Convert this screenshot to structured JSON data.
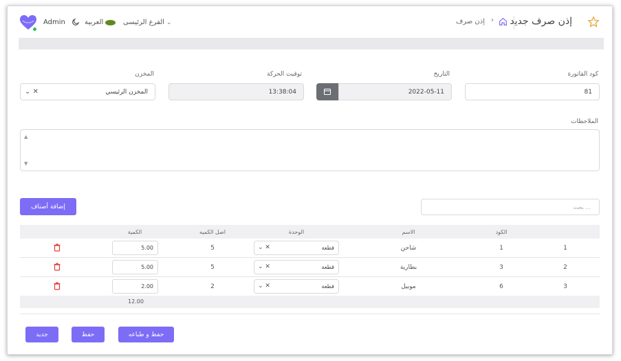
{
  "header": {
    "page_title": "إذن صرف جديد",
    "breadcrumb": "إذن صرف",
    "branch": "الفرع الرئيسى",
    "language": "العربية",
    "user": "Admin"
  },
  "form": {
    "invoice_code_label": "كود الفاتورة",
    "invoice_code_value": "81",
    "date_label": "التاريخ",
    "date_value": "2022-05-11",
    "time_label": "توقيت الحركة",
    "time_value": "13:38:04",
    "store_label": "المخزن",
    "store_value": "المخزن الرئيسي",
    "notes_label": "الملاحظات"
  },
  "items": {
    "search_placeholder": "بحث ...",
    "add_button": "إضافة أصناف",
    "columns": {
      "code": "الكود",
      "name": "الاسم",
      "unit": "الوحدة",
      "original_qty": "اصل الكميه",
      "qty": "الكمية"
    },
    "rows": [
      {
        "index": "1",
        "code": "1",
        "name": "شاحن",
        "unit": "قطعة",
        "original_qty": "5",
        "qty": "5.00"
      },
      {
        "index": "2",
        "code": "3",
        "name": "بطارية",
        "unit": "قطعة",
        "original_qty": "5",
        "qty": "5.00"
      },
      {
        "index": "3",
        "code": "6",
        "name": "موبيل",
        "unit": "قطعة",
        "original_qty": "2",
        "qty": "2.00"
      }
    ],
    "total_qty": "12.00"
  },
  "actions": {
    "save_print": "حفظ و طباعه",
    "save": "حفظ",
    "new": "جديد"
  },
  "colors": {
    "accent": "#7d6cf6",
    "delete": "#e53935",
    "calendar_button": "#6b6e72"
  }
}
